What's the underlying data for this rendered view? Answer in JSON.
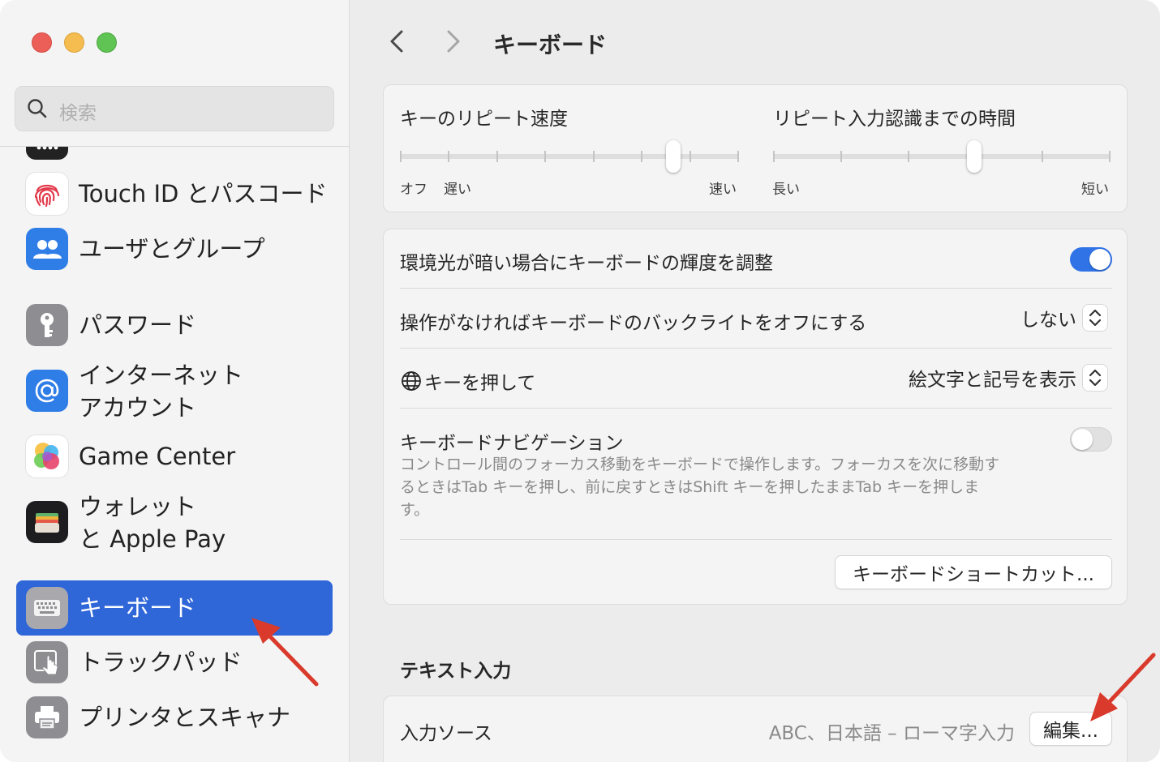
{
  "window": {
    "title": "キーボード"
  },
  "search": {
    "placeholder": "検索"
  },
  "sidebar": {
    "items": [
      {
        "label": "Touch ID とパスコード",
        "icon": "fingerprint-icon"
      },
      {
        "label": "ユーザとグループ",
        "icon": "users-icon"
      },
      {
        "label": "パスワード",
        "icon": "key-icon"
      },
      {
        "label": "インターネット\nアカウント",
        "icon": "at-icon"
      },
      {
        "label": "Game Center",
        "icon": "game-center-icon"
      },
      {
        "label": "ウォレット\nと Apple Pay",
        "icon": "wallet-icon"
      },
      {
        "label": "キーボード",
        "icon": "keyboard-icon",
        "selected": true
      },
      {
        "label": "トラックパッド",
        "icon": "trackpad-icon"
      },
      {
        "label": "プリンタとスキャナ",
        "icon": "printer-icon"
      }
    ]
  },
  "repeat": {
    "rate_title": "キーのリピート速度",
    "rate_labels": {
      "off": "オフ",
      "slow": "遅い",
      "fast": "速い"
    },
    "rate_level": 0.82,
    "delay_title": "リピート入力認識までの時間",
    "delay_labels": {
      "long": "長い",
      "short": "短い"
    },
    "delay_level": 0.6
  },
  "settings": {
    "auto_brightness_label": "環境光が暗い場合にキーボードの輝度を調整",
    "auto_brightness_on": true,
    "backlight_off_label": "操作がなければキーボードのバックライトをオフにする",
    "backlight_off_value": "しない",
    "globe_key_label": "キーを押して",
    "globe_key_value": "絵文字と記号を表示",
    "keyboard_nav_label": "キーボードナビゲーション",
    "keyboard_nav_on": false,
    "keyboard_nav_desc": "コントロール間のフォーカス移動をキーボードで操作します。フォーカスを次に移動するときはTab キーを押し、前に戻すときはShift キーを押したままTab キーを押します。",
    "shortcuts_button": "キーボードショートカット..."
  },
  "text_input": {
    "section_title": "テキスト入力",
    "input_sources_label": "入力ソース",
    "input_sources_value": "ABC、日本語 – ローマ字入力",
    "edit_button": "編集..."
  },
  "colors": {
    "accent": "#2f66d8",
    "annotation_arrow": "#d93a2b"
  }
}
